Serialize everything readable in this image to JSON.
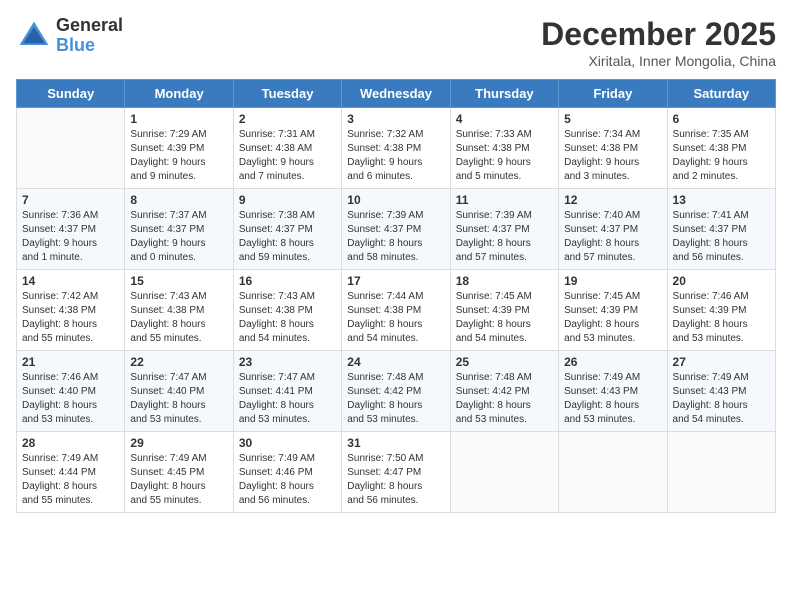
{
  "logo": {
    "general": "General",
    "blue": "Blue"
  },
  "title": "December 2025",
  "location": "Xiritala, Inner Mongolia, China",
  "days_of_week": [
    "Sunday",
    "Monday",
    "Tuesday",
    "Wednesday",
    "Thursday",
    "Friday",
    "Saturday"
  ],
  "weeks": [
    [
      {
        "day": "",
        "info": ""
      },
      {
        "day": "1",
        "info": "Sunrise: 7:29 AM\nSunset: 4:39 PM\nDaylight: 9 hours\nand 9 minutes."
      },
      {
        "day": "2",
        "info": "Sunrise: 7:31 AM\nSunset: 4:38 AM\nDaylight: 9 hours\nand 7 minutes."
      },
      {
        "day": "3",
        "info": "Sunrise: 7:32 AM\nSunset: 4:38 PM\nDaylight: 9 hours\nand 6 minutes."
      },
      {
        "day": "4",
        "info": "Sunrise: 7:33 AM\nSunset: 4:38 PM\nDaylight: 9 hours\nand 5 minutes."
      },
      {
        "day": "5",
        "info": "Sunrise: 7:34 AM\nSunset: 4:38 PM\nDaylight: 9 hours\nand 3 minutes."
      },
      {
        "day": "6",
        "info": "Sunrise: 7:35 AM\nSunset: 4:38 PM\nDaylight: 9 hours\nand 2 minutes."
      }
    ],
    [
      {
        "day": "7",
        "info": "Sunrise: 7:36 AM\nSunset: 4:37 PM\nDaylight: 9 hours\nand 1 minute."
      },
      {
        "day": "8",
        "info": "Sunrise: 7:37 AM\nSunset: 4:37 PM\nDaylight: 9 hours\nand 0 minutes."
      },
      {
        "day": "9",
        "info": "Sunrise: 7:38 AM\nSunset: 4:37 PM\nDaylight: 8 hours\nand 59 minutes."
      },
      {
        "day": "10",
        "info": "Sunrise: 7:39 AM\nSunset: 4:37 PM\nDaylight: 8 hours\nand 58 minutes."
      },
      {
        "day": "11",
        "info": "Sunrise: 7:39 AM\nSunset: 4:37 PM\nDaylight: 8 hours\nand 57 minutes."
      },
      {
        "day": "12",
        "info": "Sunrise: 7:40 AM\nSunset: 4:37 PM\nDaylight: 8 hours\nand 57 minutes."
      },
      {
        "day": "13",
        "info": "Sunrise: 7:41 AM\nSunset: 4:37 PM\nDaylight: 8 hours\nand 56 minutes."
      }
    ],
    [
      {
        "day": "14",
        "info": "Sunrise: 7:42 AM\nSunset: 4:38 PM\nDaylight: 8 hours\nand 55 minutes."
      },
      {
        "day": "15",
        "info": "Sunrise: 7:43 AM\nSunset: 4:38 PM\nDaylight: 8 hours\nand 55 minutes."
      },
      {
        "day": "16",
        "info": "Sunrise: 7:43 AM\nSunset: 4:38 PM\nDaylight: 8 hours\nand 54 minutes."
      },
      {
        "day": "17",
        "info": "Sunrise: 7:44 AM\nSunset: 4:38 PM\nDaylight: 8 hours\nand 54 minutes."
      },
      {
        "day": "18",
        "info": "Sunrise: 7:45 AM\nSunset: 4:39 PM\nDaylight: 8 hours\nand 54 minutes."
      },
      {
        "day": "19",
        "info": "Sunrise: 7:45 AM\nSunset: 4:39 PM\nDaylight: 8 hours\nand 53 minutes."
      },
      {
        "day": "20",
        "info": "Sunrise: 7:46 AM\nSunset: 4:39 PM\nDaylight: 8 hours\nand 53 minutes."
      }
    ],
    [
      {
        "day": "21",
        "info": "Sunrise: 7:46 AM\nSunset: 4:40 PM\nDaylight: 8 hours\nand 53 minutes."
      },
      {
        "day": "22",
        "info": "Sunrise: 7:47 AM\nSunset: 4:40 PM\nDaylight: 8 hours\nand 53 minutes."
      },
      {
        "day": "23",
        "info": "Sunrise: 7:47 AM\nSunset: 4:41 PM\nDaylight: 8 hours\nand 53 minutes."
      },
      {
        "day": "24",
        "info": "Sunrise: 7:48 AM\nSunset: 4:42 PM\nDaylight: 8 hours\nand 53 minutes."
      },
      {
        "day": "25",
        "info": "Sunrise: 7:48 AM\nSunset: 4:42 PM\nDaylight: 8 hours\nand 53 minutes."
      },
      {
        "day": "26",
        "info": "Sunrise: 7:49 AM\nSunset: 4:43 PM\nDaylight: 8 hours\nand 53 minutes."
      },
      {
        "day": "27",
        "info": "Sunrise: 7:49 AM\nSunset: 4:43 PM\nDaylight: 8 hours\nand 54 minutes."
      }
    ],
    [
      {
        "day": "28",
        "info": "Sunrise: 7:49 AM\nSunset: 4:44 PM\nDaylight: 8 hours\nand 55 minutes."
      },
      {
        "day": "29",
        "info": "Sunrise: 7:49 AM\nSunset: 4:45 PM\nDaylight: 8 hours\nand 55 minutes."
      },
      {
        "day": "30",
        "info": "Sunrise: 7:49 AM\nSunset: 4:46 PM\nDaylight: 8 hours\nand 56 minutes."
      },
      {
        "day": "31",
        "info": "Sunrise: 7:50 AM\nSunset: 4:47 PM\nDaylight: 8 hours\nand 56 minutes."
      },
      {
        "day": "",
        "info": ""
      },
      {
        "day": "",
        "info": ""
      },
      {
        "day": "",
        "info": ""
      }
    ]
  ]
}
